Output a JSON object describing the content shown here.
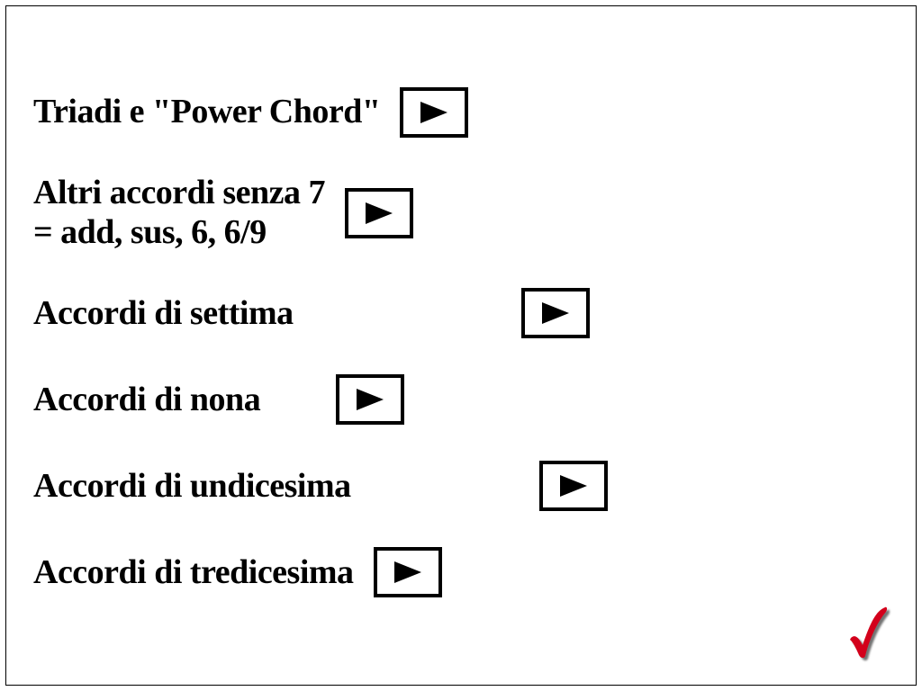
{
  "items": [
    {
      "label": "Triadi e \"Power Chord\"",
      "button_name": "play-triadi"
    },
    {
      "label": "Altri accordi senza 7\n= add, sus, 6, 6/9",
      "button_name": "play-altri-accordi-senza-7"
    },
    {
      "label": "Accordi di settima",
      "button_name": "play-accordi-settima"
    },
    {
      "label": "Accordi di nona",
      "button_name": "play-accordi-nona"
    },
    {
      "label": "Accordi di undicesima",
      "button_name": "play-accordi-undicesima"
    },
    {
      "label": "Accordi di tredicesima",
      "button_name": "play-accordi-tredicesima"
    }
  ],
  "confirm_icon": "check-icon",
  "colors": {
    "accent_red": "#d3001b",
    "text": "#000000"
  }
}
